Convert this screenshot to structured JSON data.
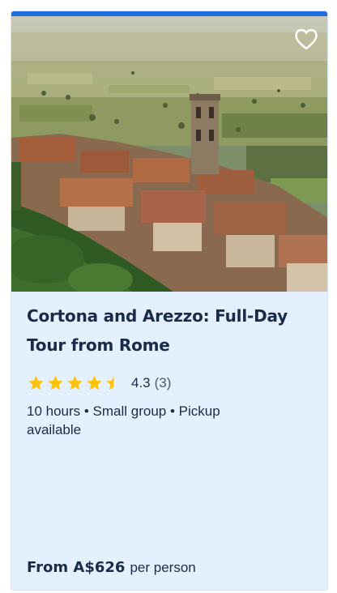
{
  "card": {
    "title": "Cortona and Arezzo: Full-Day Tour from Rome",
    "rating": {
      "value": "4.3",
      "count": "(3)",
      "stars_filled": 4.5,
      "stars_total": 5
    },
    "meta": "10 hours • Small group • Pickup available",
    "price": {
      "amount": "From A$626",
      "unit": "per person"
    },
    "favorite_icon": "heart-outline-icon"
  },
  "colors": {
    "accent": "#1f6ee0",
    "card_background": "#e4f0fd",
    "text": "#1a2b49",
    "star": "#ffc20e"
  }
}
